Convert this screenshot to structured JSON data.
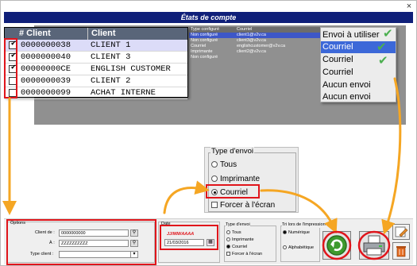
{
  "window": {
    "title": "États de compte",
    "close_glyph": "×"
  },
  "table": {
    "columns": [
      "# Client",
      "Client"
    ],
    "rows": [
      {
        "checked": true,
        "number": "0000000038",
        "client": "CLIENT 1",
        "selected": true
      },
      {
        "checked": true,
        "number": "0000000040",
        "client": "CLIENT 3",
        "selected": false
      },
      {
        "checked": true,
        "number": "00000000CE",
        "client": "ENGLISH CUSTOMER",
        "selected": false
      },
      {
        "checked": false,
        "number": "0000000039",
        "client": "CLIENT 2",
        "selected": false
      },
      {
        "checked": false,
        "number": "0000000099",
        "client": "ACHAT INTERNE",
        "selected": false
      }
    ]
  },
  "bg_table": {
    "columns": [
      "Type configuré",
      "Courriel"
    ],
    "rows": [
      {
        "type": "Non configuré",
        "email": "client1@v2v.ca"
      },
      {
        "type": "Non configuré",
        "email": "client3@v2v.ca"
      },
      {
        "type": "Courriel",
        "email": "englishcustomer@v2v.ca"
      },
      {
        "type": "Imprimante",
        "email": "client2@v2v.ca"
      },
      {
        "type": "Non configuré",
        "email": ""
      }
    ]
  },
  "envoi_dropdown": {
    "header": "Envoi à utiliser",
    "items": [
      {
        "label": "Courriel",
        "highlighted": true,
        "checked": true
      },
      {
        "label": "Courriel",
        "highlighted": false,
        "checked": true
      },
      {
        "label": "Courriel",
        "highlighted": false,
        "checked": true
      },
      {
        "label": "Aucun envoi",
        "highlighted": false,
        "checked": false
      },
      {
        "label": "Aucun envoi",
        "highlighted": false,
        "checked": false
      }
    ]
  },
  "type_envoi_zoom": {
    "legend": "Type d'envoi",
    "options": [
      "Tous",
      "Imprimante",
      "Courriel"
    ],
    "selected": "Courriel",
    "force_label": "Forcer à l'écran"
  },
  "options_panel": {
    "legend": "Options",
    "client_de_label": "Client de :",
    "client_de_value": "0000000000",
    "a_label": "À :",
    "a_value": "ZZZZZZZZZZ",
    "type_client_label": "Type client :",
    "type_client_value": ""
  },
  "date_panel": {
    "legend": "Date",
    "format_hint": "JJ/MM/AAAA",
    "value": "21/03/2016"
  },
  "type_envoi_small": {
    "legend": "Type d'envoi",
    "options": [
      "Tous",
      "Imprimante",
      "Courriel"
    ],
    "selected": "Courriel",
    "force_label": "Forcer à l'écran"
  },
  "tri_panel": {
    "legend": "Tri lors de l'impression",
    "options": [
      "Numérique",
      "Alphabétique"
    ],
    "selected": "Numérique"
  },
  "colors": {
    "banner": "#0f1f79",
    "table_header": "#596579",
    "highlight": "#e0151b",
    "arrow": "#f5a623",
    "selection": "#3c68d8"
  },
  "icons": [
    "refresh-icon",
    "printer-icon",
    "edit-icon",
    "trash-icon",
    "calendar-icon",
    "search-icon"
  ]
}
